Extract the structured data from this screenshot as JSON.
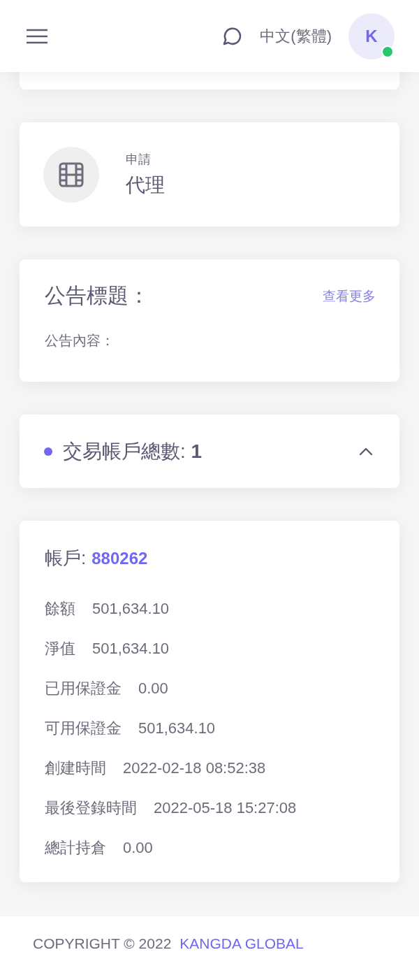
{
  "header": {
    "language": "中文(繁體)",
    "avatar_initial": "K",
    "online": true
  },
  "apply_card": {
    "caption": "申請",
    "title": "代理"
  },
  "announcement": {
    "title": "公告標題：",
    "more_link": "查看更多",
    "content": "公告內容："
  },
  "accounts_summary": {
    "label": "交易帳戶總數:",
    "count": "1",
    "expanded": true
  },
  "account": {
    "label": "帳戶:",
    "number": "880262",
    "fields": [
      {
        "label": "餘額",
        "value": "501,634.10"
      },
      {
        "label": "淨值",
        "value": "501,634.10"
      },
      {
        "label": "已用保證金",
        "value": "0.00"
      },
      {
        "label": "可用保證金",
        "value": "501,634.10"
      },
      {
        "label": "創建時間",
        "value": "2022-02-18 08:52:38"
      },
      {
        "label": "最後登錄時間",
        "value": "2022-05-18 15:27:08"
      },
      {
        "label": "總計持倉",
        "value": "0.00"
      }
    ]
  },
  "footer": {
    "copyright": "COPYRIGHT © 2022",
    "company": "KANGDA GLOBAL"
  }
}
